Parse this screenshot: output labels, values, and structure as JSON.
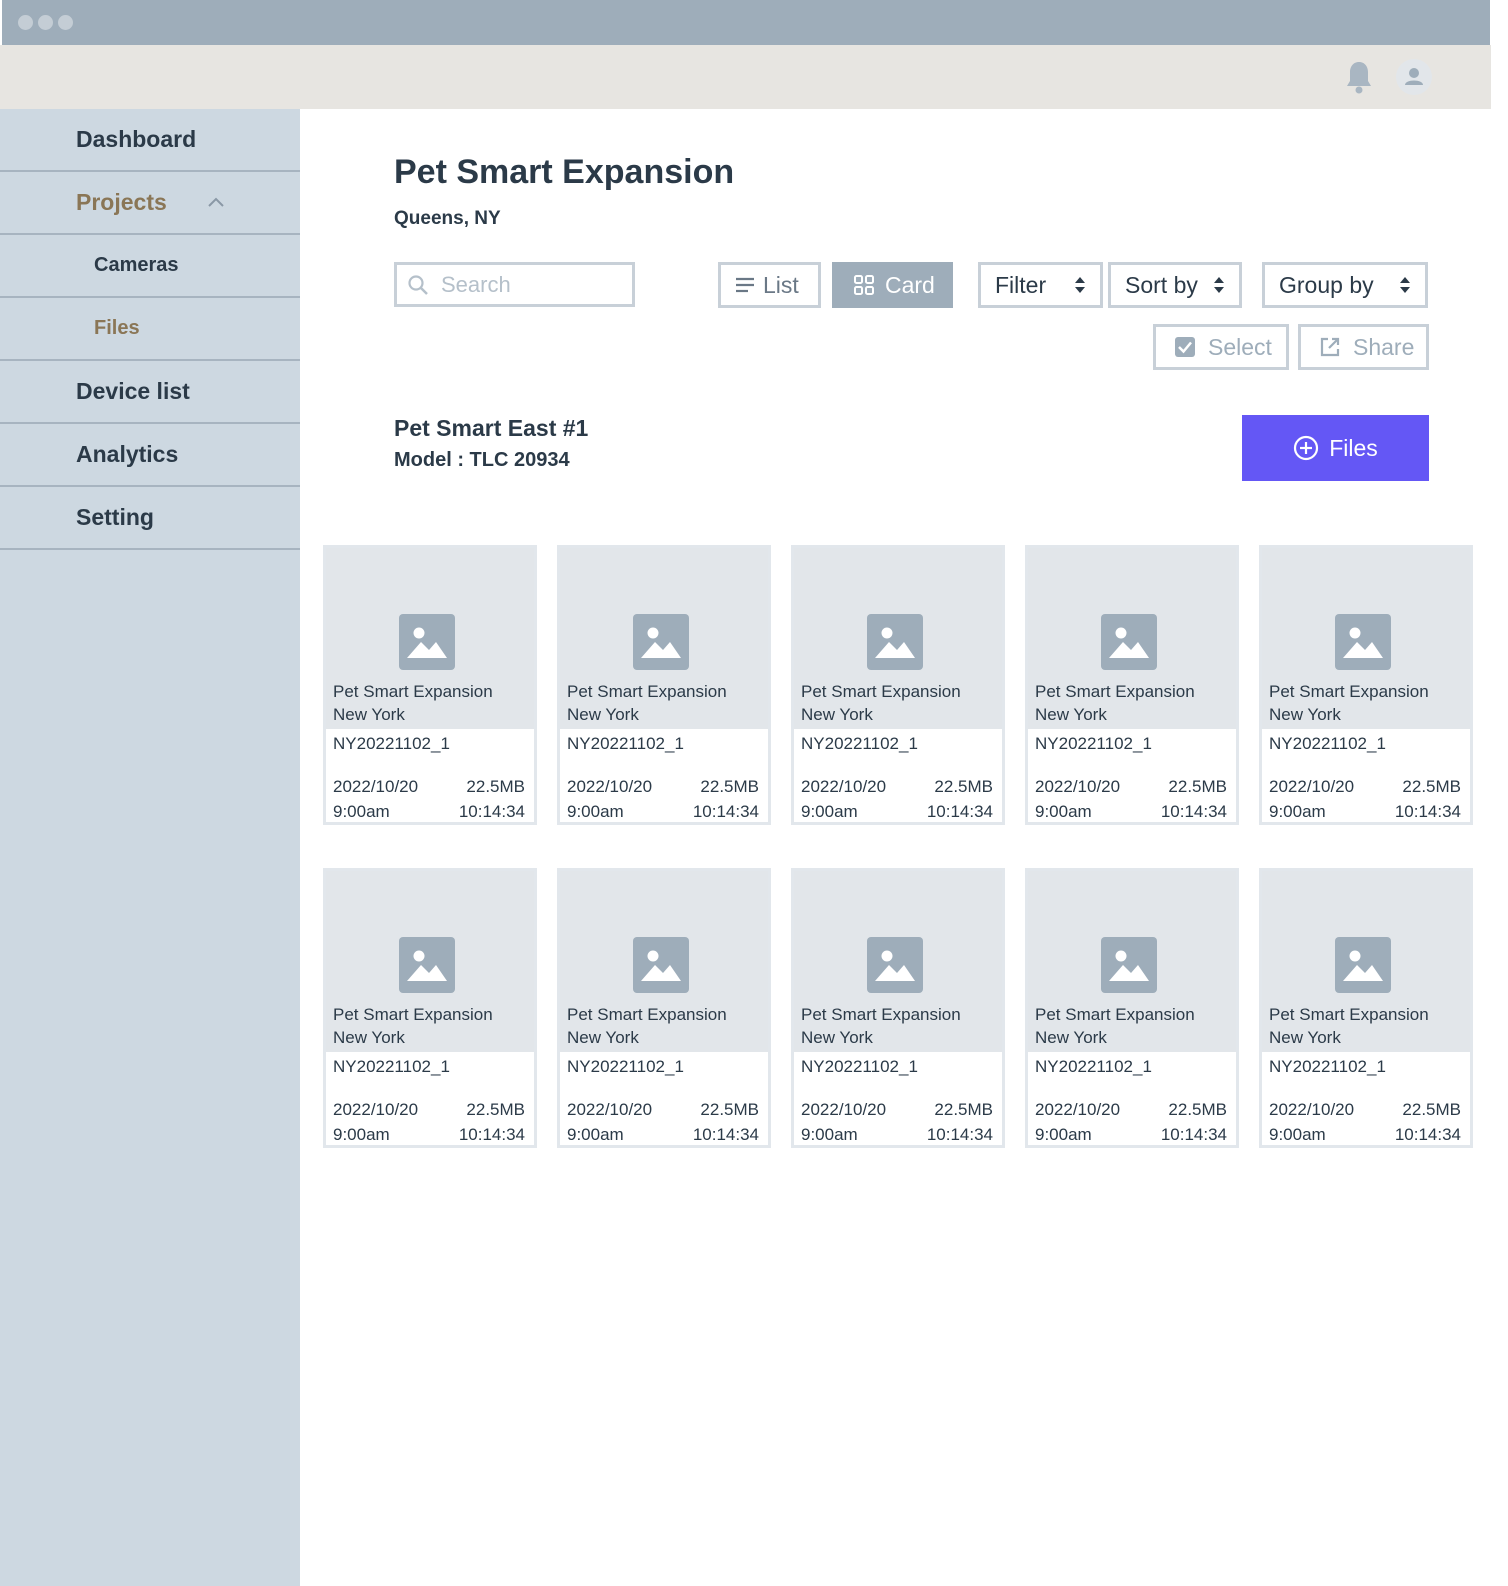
{
  "window": {
    "controls": [
      "close",
      "minimize",
      "maximize"
    ]
  },
  "topbar": {
    "notification_icon": "bell-icon",
    "avatar_icon": "user-icon"
  },
  "sidebar": {
    "items": [
      {
        "label": "Dashboard",
        "level": "main",
        "active": false
      },
      {
        "label": "Projects",
        "level": "main",
        "active": true,
        "expanded": true
      },
      {
        "label": "Cameras",
        "level": "sub",
        "active": false
      },
      {
        "label": "Files",
        "level": "sub",
        "active": true
      },
      {
        "label": "Device list",
        "level": "main",
        "active": false
      },
      {
        "label": "Analytics",
        "level": "main",
        "active": false
      },
      {
        "label": "Setting",
        "level": "main",
        "active": false
      }
    ]
  },
  "header": {
    "title": "Pet Smart Expansion",
    "subtitle": "Queens, NY"
  },
  "toolbar": {
    "search_placeholder": "Search",
    "view_list_label": "List",
    "view_card_label": "Card",
    "active_view": "Card",
    "filter_label": "Filter",
    "sort_label": "Sort by",
    "group_label": "Group by",
    "select_label": "Select",
    "share_label": "Share"
  },
  "device": {
    "name": "Pet Smart East #1",
    "model": "Model : TLC 20934",
    "add_files_label": "Files"
  },
  "files": [
    {
      "name": "Pet Smart Expansion",
      "location": "New York",
      "id": "NY20221102_1",
      "date": "2022/10/20",
      "time": "9:00am",
      "size": "22.5MB",
      "duration": "10:14:34"
    },
    {
      "name": "Pet Smart Expansion",
      "location": "New York",
      "id": "NY20221102_1",
      "date": "2022/10/20",
      "time": "9:00am",
      "size": "22.5MB",
      "duration": "10:14:34"
    },
    {
      "name": "Pet Smart Expansion",
      "location": "New York",
      "id": "NY20221102_1",
      "date": "2022/10/20",
      "time": "9:00am",
      "size": "22.5MB",
      "duration": "10:14:34"
    },
    {
      "name": "Pet Smart Expansion",
      "location": "New York",
      "id": "NY20221102_1",
      "date": "2022/10/20",
      "time": "9:00am",
      "size": "22.5MB",
      "duration": "10:14:34"
    },
    {
      "name": "Pet Smart Expansion",
      "location": "New York",
      "id": "NY20221102_1",
      "date": "2022/10/20",
      "time": "9:00am",
      "size": "22.5MB",
      "duration": "10:14:34"
    },
    {
      "name": "Pet Smart Expansion",
      "location": "New York",
      "id": "NY20221102_1",
      "date": "2022/10/20",
      "time": "9:00am",
      "size": "22.5MB",
      "duration": "10:14:34"
    },
    {
      "name": "Pet Smart Expansion",
      "location": "New York",
      "id": "NY20221102_1",
      "date": "2022/10/20",
      "time": "9:00am",
      "size": "22.5MB",
      "duration": "10:14:34"
    },
    {
      "name": "Pet Smart Expansion",
      "location": "New York",
      "id": "NY20221102_1",
      "date": "2022/10/20",
      "time": "9:00am",
      "size": "22.5MB",
      "duration": "10:14:34"
    },
    {
      "name": "Pet Smart Expansion",
      "location": "New York",
      "id": "NY20221102_1",
      "date": "2022/10/20",
      "time": "9:00am",
      "size": "22.5MB",
      "duration": "10:14:34"
    },
    {
      "name": "Pet Smart Expansion",
      "location": "New York",
      "id": "NY20221102_1",
      "date": "2022/10/20",
      "time": "9:00am",
      "size": "22.5MB",
      "duration": "10:14:34"
    }
  ],
  "colors": {
    "accent": "#6457f5",
    "sidebar_bg": "#cdd8e1",
    "active_nav": "#8a7656",
    "titlebar": "#9eadba"
  }
}
